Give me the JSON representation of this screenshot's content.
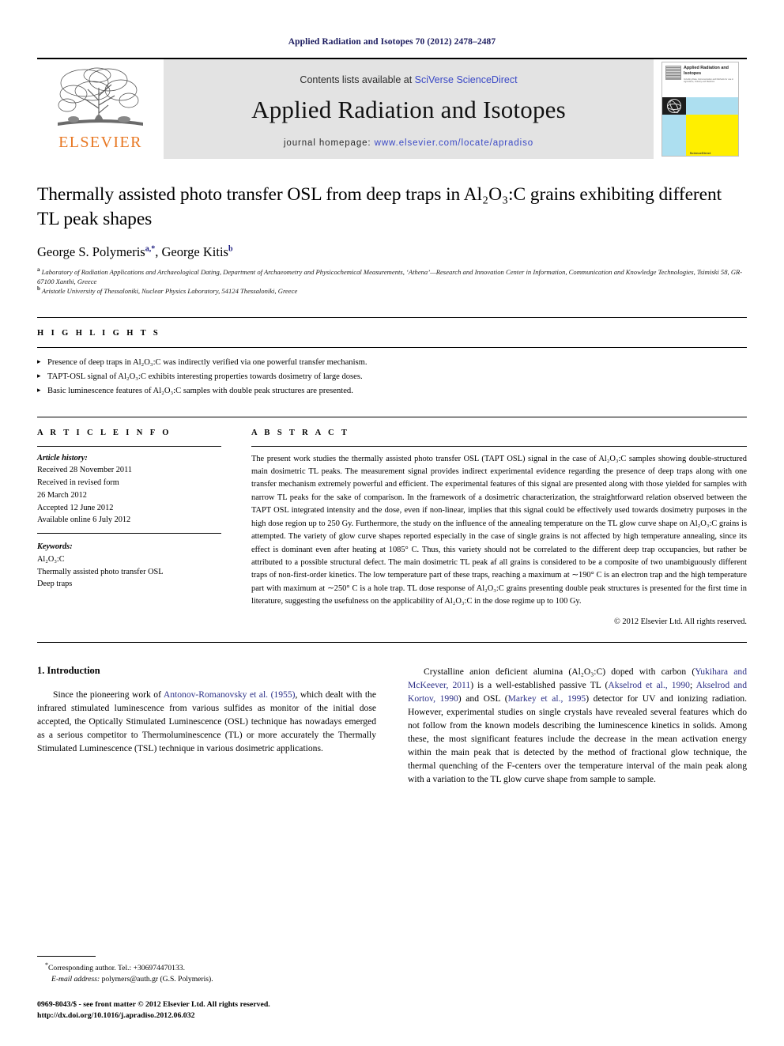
{
  "running_head": "Applied Radiation and Isotopes 70 (2012) 2478–2487",
  "masthead": {
    "publisher_logo_text": "ELSEVIER",
    "contents_prefix": "Contents lists available at ",
    "contents_link": "SciVerse ScienceDirect",
    "journal_name": "Applied Radiation and Isotopes",
    "homepage_prefix": "journal homepage: ",
    "homepage_url": "www.elsevier.com/locate/apradiso",
    "cover": {
      "title": "Applied Radiation and Isotopes",
      "subtitle": "Including Data, Instrumentation and Methods for use in Agriculture, Industry and Medicine",
      "brand": "ScienceDirect"
    },
    "link_color": "#3a49c6",
    "band_color": "#e3e3e3",
    "elsevier_orange": "#E87722"
  },
  "article": {
    "title": "Thermally assisted photo transfer OSL from deep traps in Al₂O₃:C grains exhibiting different TL peak shapes",
    "authors": "George S. Polymeris, George Kitis",
    "author_1": "George S. Polymeris",
    "author_1_sup": "a,*",
    "author_2": "George Kitis",
    "author_2_sup": "b",
    "affiliation_a_sup": "a",
    "affiliation_a": "Laboratory of Radiation Applications and Archaeological Dating, Department of Archaeometry and Physicochemical Measurements, ‘Athena’—Research and Innovation Center in Information, Communication and Knowledge Technologies, Tsimiski 58, GR-67100 Xanthi, Greece",
    "affiliation_b_sup": "b",
    "affiliation_b": "Aristotle University of Thessaloniki, Nuclear Physics Laboratory, 54124 Thessaloniki, Greece"
  },
  "highlights": {
    "label": "H I G H L I G H T S",
    "items": [
      "Presence of deep traps in Al₂O₃:C was indirectly verified via one powerful transfer mechanism.",
      "TAPT-OSL signal of Al₂O₃:C exhibits interesting properties towards dosimetry of large doses.",
      "Basic luminescence features of Al₂O₃:C samples with double peak structures are presented."
    ]
  },
  "article_info": {
    "label": "A R T I C L E   I N F O",
    "history_label": "Article history:",
    "history_lines": [
      "Received 28 November 2011",
      "Received in revised form",
      "26 March 2012",
      "Accepted 12 June 2012",
      "Available online 6 July 2012"
    ],
    "keywords_label": "Keywords:",
    "keywords": [
      "Al₂O₃:C",
      "Thermally assisted photo transfer OSL",
      "Deep traps"
    ]
  },
  "abstract": {
    "label": "A B S T R A C T",
    "text": "The present work studies the thermally assisted photo transfer OSL (TAPT OSL) signal in the case of Al₂O₃:C samples showing double-structured main dosimetric TL peaks. The measurement signal provides indirect experimental evidence regarding the presence of deep traps along with one transfer mechanism extremely powerful and efficient. The experimental features of this signal are presented along with those yielded for samples with narrow TL peaks for the sake of comparison. In the framework of a dosimetric characterization, the straightforward relation observed between the TAPT OSL integrated intensity and the dose, even if non-linear, implies that this signal could be effectively used towards dosimetry purposes in the high dose region up to 250 Gy. Furthermore, the study on the influence of the annealing temperature on the TL glow curve shape on Al₂O₃:C grains is attempted. The variety of glow curve shapes reported especially in the case of single grains is not affected by high temperature annealing, since its effect is dominant even after heating at 1085° C. Thus, this variety should not be correlated to the different deep trap occupancies, but rather be attributed to a possible structural defect. The main dosimetric TL peak af all grains is considered to be a composite of two unambiguously different traps of non-first-order kinetics. The low temperature part of these traps, reaching a maximum at ∼190° C is an electron trap and the high temperature part with maximum at ∼250° C is a hole trap. TL dose response of Al₂O₃:C grains presenting double peak structures is presented for the first time in literature, suggesting the usefulness on the applicability of Al₂O₃:C in the dose regime up to 100 Gy.",
    "copyright": "© 2012 Elsevier Ltd. All rights reserved."
  },
  "body": {
    "section_number_title": "1.  Introduction",
    "left_paragraph_prefix": "Since the pioneering work of ",
    "left_citation_1": "Antonov-Romanovsky et al. (1955)",
    "left_paragraph_rest": ", which dealt with the infrared stimulated luminescence from various sulfides as monitor of the initial dose accepted, the Optically Stimulated Luminescence (OSL) technique has nowadays emerged as a serious competitor to Thermoluminescence (TL) or more accurately the Thermally Stimulated Luminescence (TSL) technique in various dosimetric applications.",
    "right_p1_a": "Crystalline anion deficient alumina (Al₂O₃:C) doped with carbon (",
    "right_cite_1": "Yukihara and McKeever, 2011",
    "right_p1_b": ") is a well-established passive TL (",
    "right_cite_2": "Akselrod et al., 1990",
    "right_p1_c": "; ",
    "right_cite_3": "Akselrod and Kortov, 1990",
    "right_p1_d": ") and OSL (",
    "right_cite_4": "Markey et al., 1995",
    "right_p1_e": ") detector for UV and ionizing radiation. However, experimental studies on single crystals have revealed several features which do not follow from the known models describing the luminescence kinetics in solids. Among these, the most significant features include the decrease in the mean activation energy within the main peak that is detected by the method of fractional glow technique, the thermal quenching of the F-centers over the temperature interval of the main peak along with a variation to the TL glow curve shape from sample to sample."
  },
  "footer": {
    "corresponding_marker": "*",
    "corresponding_text": "Corresponding author. Tel.: +306974470133.",
    "email_label": "E-mail address:",
    "email_value": "polymers@auth.gr (G.S. Polymeris).",
    "issn_line": "0969-8043/$ - see front matter © 2012 Elsevier Ltd. All rights reserved.",
    "doi_line": "http://dx.doi.org/10.1016/j.apradiso.2012.06.032"
  }
}
